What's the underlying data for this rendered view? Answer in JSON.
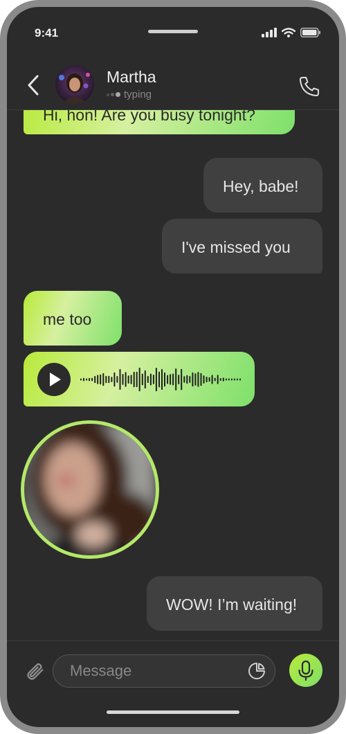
{
  "status_bar": {
    "time": "9:41",
    "icons": [
      "cellular-signal-icon",
      "wifi-icon",
      "battery-icon"
    ]
  },
  "header": {
    "back_icon": "chevron-left-icon",
    "contact_name": "Martha",
    "contact_status": "typing",
    "call_icon": "phone-icon"
  },
  "messages": [
    {
      "direction": "incoming",
      "type": "text",
      "text": "Hi, hon! Are you busy tonight?"
    },
    {
      "direction": "outgoing",
      "type": "text",
      "text": "Hey, babe!"
    },
    {
      "direction": "outgoing",
      "type": "text",
      "text": "I've missed you"
    },
    {
      "direction": "incoming",
      "type": "text",
      "text": "me too"
    },
    {
      "direction": "incoming",
      "type": "voice",
      "icon": "play-icon"
    },
    {
      "direction": "incoming",
      "type": "video-note"
    },
    {
      "direction": "outgoing",
      "type": "text",
      "text": "WOW! I’m waiting!"
    }
  ],
  "composer": {
    "attach_icon": "paperclip-icon",
    "placeholder": "Message",
    "sticker_icon": "sticker-icon",
    "mic_icon": "microphone-icon"
  },
  "colors": {
    "background": "#2b2b2b",
    "frame": "#8a8a8a",
    "incoming_gradient": [
      "#b8ea3a",
      "#d6f0a0",
      "#7ee06a"
    ],
    "outgoing_bubble": "#404040",
    "text_light": "#e6e6e6",
    "text_muted": "#888888"
  }
}
